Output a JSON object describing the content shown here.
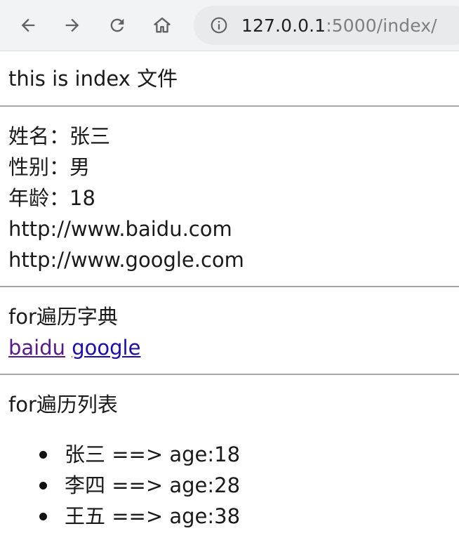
{
  "browser": {
    "url_host": "127.0.0.1",
    "url_rest": ":5000/index/",
    "icons": {
      "back": "arrow-left-icon",
      "forward": "arrow-right-icon",
      "reload": "reload-icon",
      "home": "home-icon",
      "info": "info-icon"
    }
  },
  "page": {
    "heading": "this is index 文件",
    "info": {
      "name": "姓名：张三",
      "gender": "性别：男",
      "age": "年龄：18",
      "url1": "http://www.baidu.com",
      "url2": "http://www.google.com"
    },
    "dict_section": {
      "title": "for遍历字典",
      "links": [
        "baidu",
        "google"
      ]
    },
    "list_section": {
      "title": "for遍历列表",
      "items": [
        "张三 ==> age:18",
        "李四 ==> age:28",
        "王五 ==> age:38"
      ]
    }
  },
  "colors": {
    "visited_link": "#551a8b",
    "link": "#1a0dab",
    "toolbar_bg": "#f1f3f4",
    "omnibox_bg": "#e8eaed"
  }
}
